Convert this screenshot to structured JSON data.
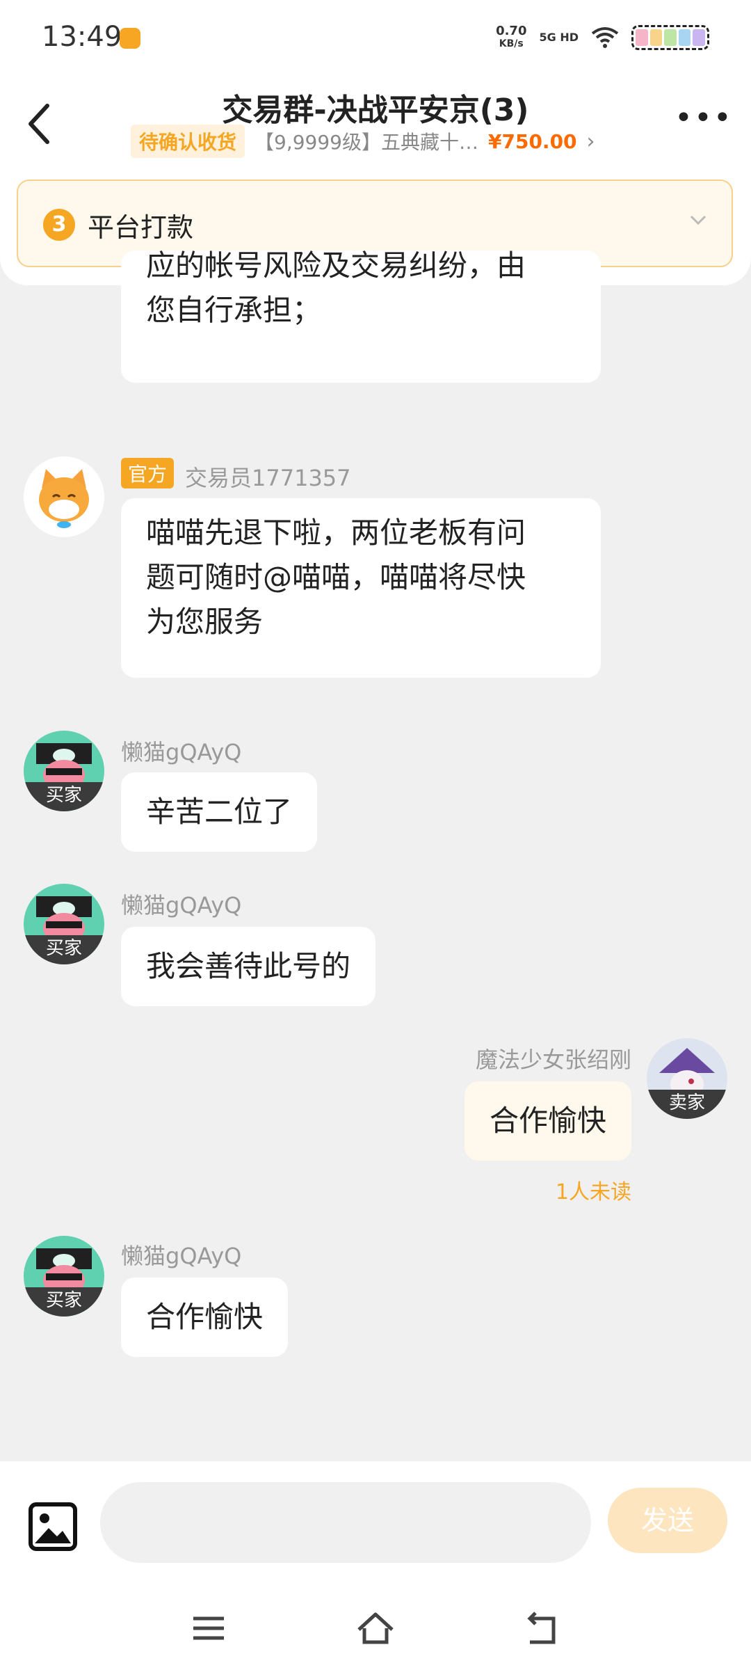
{
  "status_bar": {
    "time": "13:49",
    "net_speed_value": "0.70",
    "net_speed_unit": "KB/s",
    "network": "5G HD"
  },
  "header": {
    "title": "交易群-决战平安京(3)",
    "order_status": "待确认收货",
    "product": "【9,9999级】五典藏十…",
    "price": "¥750.00"
  },
  "progress": {
    "step": "3",
    "label": "平台打款"
  },
  "messages": [
    {
      "side": "left",
      "text_lines": [
        "应的帐号风险及交易纠纷，由",
        "您自行承担；"
      ]
    },
    {
      "side": "left",
      "official_tag": "官方",
      "name": "交易员1771357",
      "text_lines": [
        "喵喵先退下啦，两位老板有问",
        "题可随时@喵喵，喵喵将尽快",
        "为您服务"
      ]
    },
    {
      "side": "left",
      "name": "懒猫gQAyQ",
      "role": "买家",
      "text_lines": [
        "辛苦二位了"
      ]
    },
    {
      "side": "left",
      "name": "懒猫gQAyQ",
      "role": "买家",
      "text_lines": [
        "我会善待此号的"
      ]
    },
    {
      "side": "right",
      "name": "魔法少女张绍刚",
      "role": "卖家",
      "text_lines": [
        "合作愉快"
      ],
      "read_status": "1人未读"
    },
    {
      "side": "left",
      "name": "懒猫gQAyQ",
      "role": "买家",
      "text_lines": [
        "合作愉快"
      ]
    }
  ],
  "input": {
    "placeholder": "",
    "send_label": "发送"
  },
  "colors": {
    "accent": "#f5a623",
    "price": "#ff6a00",
    "background": "#f0f0f0"
  },
  "icons": [
    "back-arrow-icon",
    "more-dots-icon",
    "chevron-down-icon",
    "image-icon",
    "menu-icon",
    "home-icon",
    "back-nav-icon"
  ]
}
